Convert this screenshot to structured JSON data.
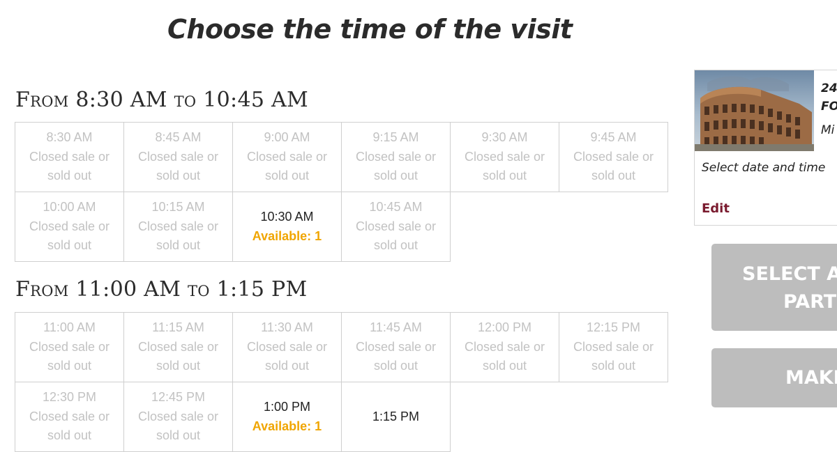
{
  "page": {
    "title": "Choose the time of the visit"
  },
  "ranges": [
    {
      "heading": "From 8:30 AM to 10:45 AM",
      "slots": [
        {
          "time": "8:30 AM",
          "status": "Closed sale or sold out",
          "state": "closed"
        },
        {
          "time": "8:45 AM",
          "status": "Closed sale or sold out",
          "state": "closed"
        },
        {
          "time": "9:00 AM",
          "status": "Closed sale or sold out",
          "state": "closed"
        },
        {
          "time": "9:15 AM",
          "status": "Closed sale or sold out",
          "state": "closed"
        },
        {
          "time": "9:30 AM",
          "status": "Closed sale or sold out",
          "state": "closed"
        },
        {
          "time": "9:45 AM",
          "status": "Closed sale or sold out",
          "state": "closed"
        },
        {
          "time": "10:00 AM",
          "status": "Closed sale or sold out",
          "state": "closed"
        },
        {
          "time": "10:15 AM",
          "status": "Closed sale or sold out",
          "state": "closed"
        },
        {
          "time": "10:30 AM",
          "status": "Available: 1",
          "state": "available"
        },
        {
          "time": "10:45 AM",
          "status": "Closed sale or sold out",
          "state": "closed"
        }
      ]
    },
    {
      "heading": "From 11:00 AM to 1:15 PM",
      "slots": [
        {
          "time": "11:00 AM",
          "status": "Closed sale or sold out",
          "state": "closed"
        },
        {
          "time": "11:15 AM",
          "status": "Closed sale or sold out",
          "state": "closed"
        },
        {
          "time": "11:30 AM",
          "status": "Closed sale or sold out",
          "state": "closed"
        },
        {
          "time": "11:45 AM",
          "status": "Closed sale or sold out",
          "state": "closed"
        },
        {
          "time": "12:00 PM",
          "status": "Closed sale or sold out",
          "state": "closed"
        },
        {
          "time": "12:15 PM",
          "status": "Closed sale or sold out",
          "state": "closed"
        },
        {
          "time": "12:30 PM",
          "status": "Closed sale or sold out",
          "state": "closed"
        },
        {
          "time": "12:45 PM",
          "status": "Closed sale or sold out",
          "state": "closed"
        },
        {
          "time": "1:00 PM",
          "status": "Available: 1",
          "state": "available"
        },
        {
          "time": "1:15 PM",
          "status": "",
          "state": "available"
        }
      ]
    }
  ],
  "summary": {
    "date": "24",
    "name": "FO",
    "subtitle": "Mi",
    "select_label": "Select date and time",
    "edit_label": "Edit",
    "image": "colosseum-photo"
  },
  "buttons": {
    "attractions": {
      "line1": "SELECT AT",
      "line2": "PART"
    },
    "make": {
      "line1": "MAKI"
    }
  },
  "colors": {
    "available": "#f0a500",
    "closed_text": "#c2c2c2",
    "edit_link": "#7a1b2f",
    "button_bg": "#bdbdbd"
  }
}
